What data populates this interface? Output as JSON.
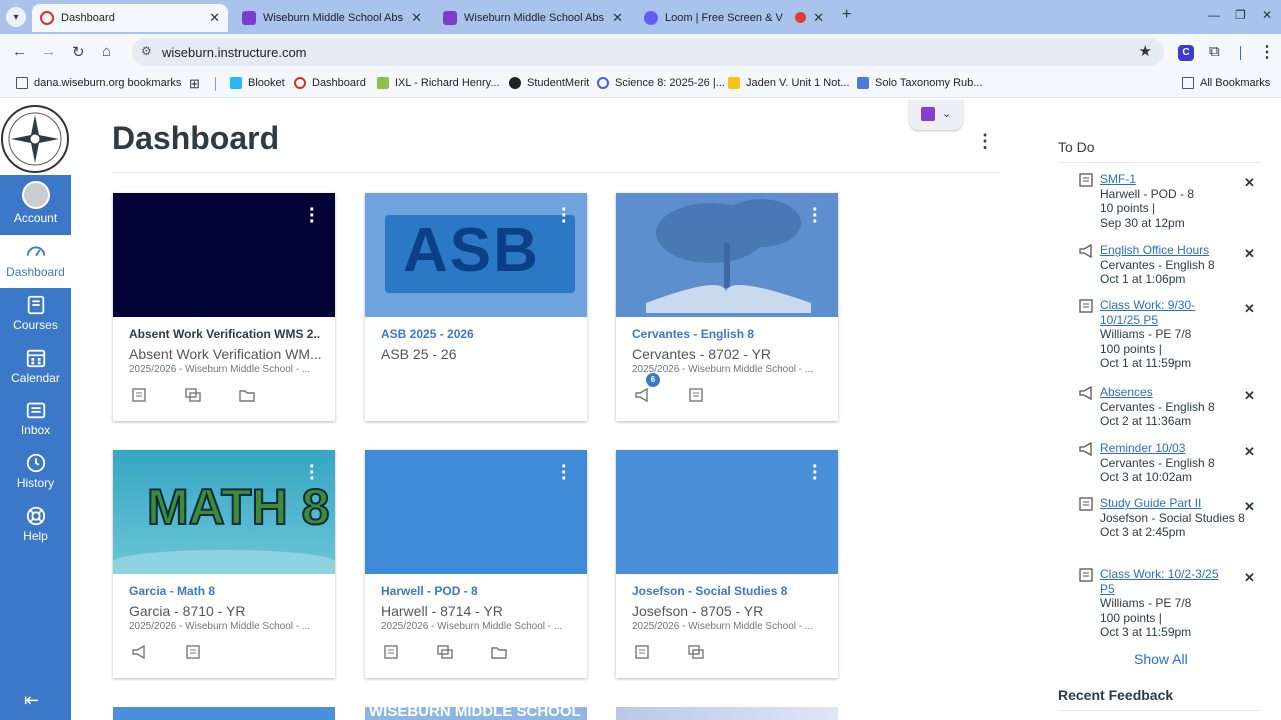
{
  "browser": {
    "tabs": [
      {
        "title": "Dashboard",
        "color": "#d93025"
      },
      {
        "title": "Wiseburn Middle School Absen",
        "color": "#7a3fc8"
      },
      {
        "title": "Wiseburn Middle School Absen",
        "color": "#7a3fc8"
      },
      {
        "title": "Loom | Free Screen & Video",
        "color": "#625df5"
      }
    ],
    "new_tab": "+",
    "url": "wiseburn.instructure.com",
    "bookmarks": [
      {
        "label": "dana.wiseburn.org bookmarks",
        "icon": "folder-icon"
      },
      {
        "label": "Blooket",
        "color": "#29b6f6"
      },
      {
        "label": "Dashboard",
        "color": "#d93025"
      },
      {
        "label": "IXL - Richard Henry...",
        "color": "#8bc34a"
      },
      {
        "label": "StudentMerit",
        "color": "#222222"
      },
      {
        "label": "Science 8: 2025-26 |...",
        "color": "#4a5bdc"
      },
      {
        "label": "Jaden V. Unit 1 Not...",
        "color": "#f5c518"
      },
      {
        "label": "Solo Taxonomy Rub...",
        "color": "#4a7bd8"
      }
    ],
    "all_bookmarks": "All Bookmarks"
  },
  "nav": {
    "items": [
      {
        "label": "Account",
        "icon": "account-icon"
      },
      {
        "label": "Dashboard",
        "icon": "dashboard-icon"
      },
      {
        "label": "Courses",
        "icon": "courses-icon"
      },
      {
        "label": "Calendar",
        "icon": "calendar-icon"
      },
      {
        "label": "Inbox",
        "icon": "inbox-icon"
      },
      {
        "label": "History",
        "icon": "history-icon"
      },
      {
        "label": "Help",
        "icon": "help-icon"
      }
    ]
  },
  "main": {
    "title": "Dashboard",
    "cards": [
      {
        "title": "Absent Work Verification WMS 2...",
        "subtitle": "Absent Work Verification WM...",
        "term": "2025/2026 - Wiseburn Middle School - ...",
        "color": "#020438",
        "title_color": "#2d3b45"
      },
      {
        "title": "ASB 2025 - 2026",
        "subtitle": "ASB 25 - 26",
        "term": "",
        "color": "#2b78c4",
        "title_color": "#3c78c8"
      },
      {
        "title": "Cervantes - English 8",
        "subtitle": "Cervantes - 8702 - YR",
        "term": "2025/2026 - Wiseburn Middle School - ...",
        "color": "#5d8fcf",
        "title_color": "#3c78c8",
        "badge": "6"
      },
      {
        "title": "Garcia - Math 8",
        "subtitle": "Garcia - 8710 - YR",
        "term": "2025/2026 - Wiseburn Middle School - ...",
        "color": "#35a6c2",
        "title_color": "#3c78c8"
      },
      {
        "title": "Harwell - POD - 8",
        "subtitle": "Harwell - 8714 - YR",
        "term": "2025/2026 - Wiseburn Middle School - ...",
        "color": "#3f8ad6",
        "title_color": "#3c78c8"
      },
      {
        "title": "Josefson - Social Studies 8",
        "subtitle": "Josefson - 8705 - YR",
        "term": "2025/2026 - Wiseburn Middle School - ...",
        "color": "#4a90d9",
        "title_color": "#3c78c8"
      }
    ],
    "asb_text": "ASB",
    "math_text": "MATH 8",
    "partial_banner": "WISEBURN MIDDLE SCHOOL"
  },
  "todo": {
    "heading": "To Do",
    "items": [
      {
        "link": "SMF-1",
        "course": "Harwell - POD - 8",
        "points": "10 points  |",
        "date": "Sep 30 at 12pm",
        "icon": "assignment-icon"
      },
      {
        "link": "English Office Hours",
        "course": "Cervantes - English 8",
        "points": "",
        "date": "Oct 1 at 1:06pm",
        "icon": "announcement-icon"
      },
      {
        "link": "Class Work: 9/30-10/1/25 P5",
        "course": "Williams - PE 7/8",
        "points": "100 points  |",
        "date": "Oct 1 at 11:59pm",
        "icon": "assignment-icon"
      },
      {
        "link": "Absences",
        "course": "Cervantes - English 8",
        "points": "",
        "date": "Oct 2 at 11:36am",
        "icon": "announcement-icon"
      },
      {
        "link": "Reminder 10/03",
        "course": "Cervantes - English 8",
        "points": "",
        "date": "Oct 3 at 10:02am",
        "icon": "announcement-icon"
      },
      {
        "link": "Study Guide Part II",
        "course": "Josefson - Social Studies 8",
        "points": "",
        "date": "Oct 3 at 2:45pm",
        "icon": "assignment-icon"
      },
      {
        "link": "Class Work: 10/2-3/25 P5",
        "course": "Williams - PE 7/8",
        "points": "100 points  |",
        "date": "Oct 3 at 11:59pm",
        "icon": "assignment-icon"
      }
    ],
    "show_all": "Show All"
  },
  "recent_feedback": "Recent Feedback"
}
